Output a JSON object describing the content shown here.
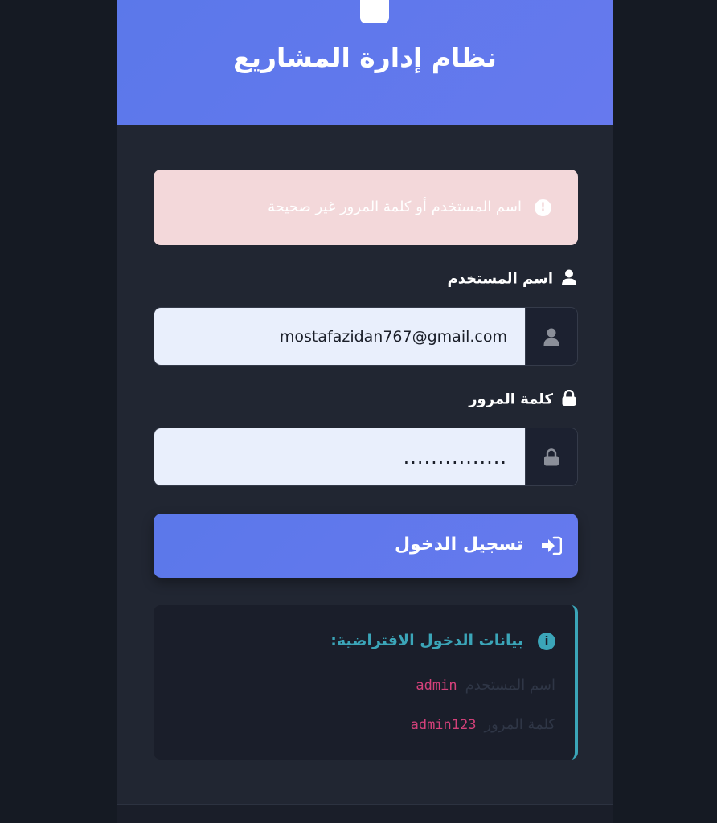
{
  "header": {
    "title": "نظام إدارة المشاريع",
    "icon": "clipboard-icon"
  },
  "alert": {
    "icon": "exclamation-circle-icon",
    "message": "اسم المستخدم أو كلمة المرور غير صحيحة"
  },
  "username": {
    "label": "اسم المستخدم",
    "label_icon": "user-icon",
    "value": "mostafazidan767@gmail.com",
    "addon_icon": "user-icon"
  },
  "password": {
    "label": "كلمة المرور",
    "label_icon": "lock-icon",
    "value": "...............",
    "addon_icon": "lock-icon"
  },
  "login_button": {
    "label": "تسجيل الدخول",
    "icon": "sign-in-icon"
  },
  "info": {
    "icon": "info-circle-icon",
    "title": "بيانات الدخول الافتراضية:",
    "rows": [
      {
        "key": "اسم المستخدم",
        "value": "admin"
      },
      {
        "key": "كلمة المرور",
        "value": "admin123"
      }
    ]
  },
  "colors": {
    "accent": "#5b78ea",
    "info": "#3ba5b8",
    "code": "#d4417a",
    "alert_bg": "#f3d8da"
  }
}
